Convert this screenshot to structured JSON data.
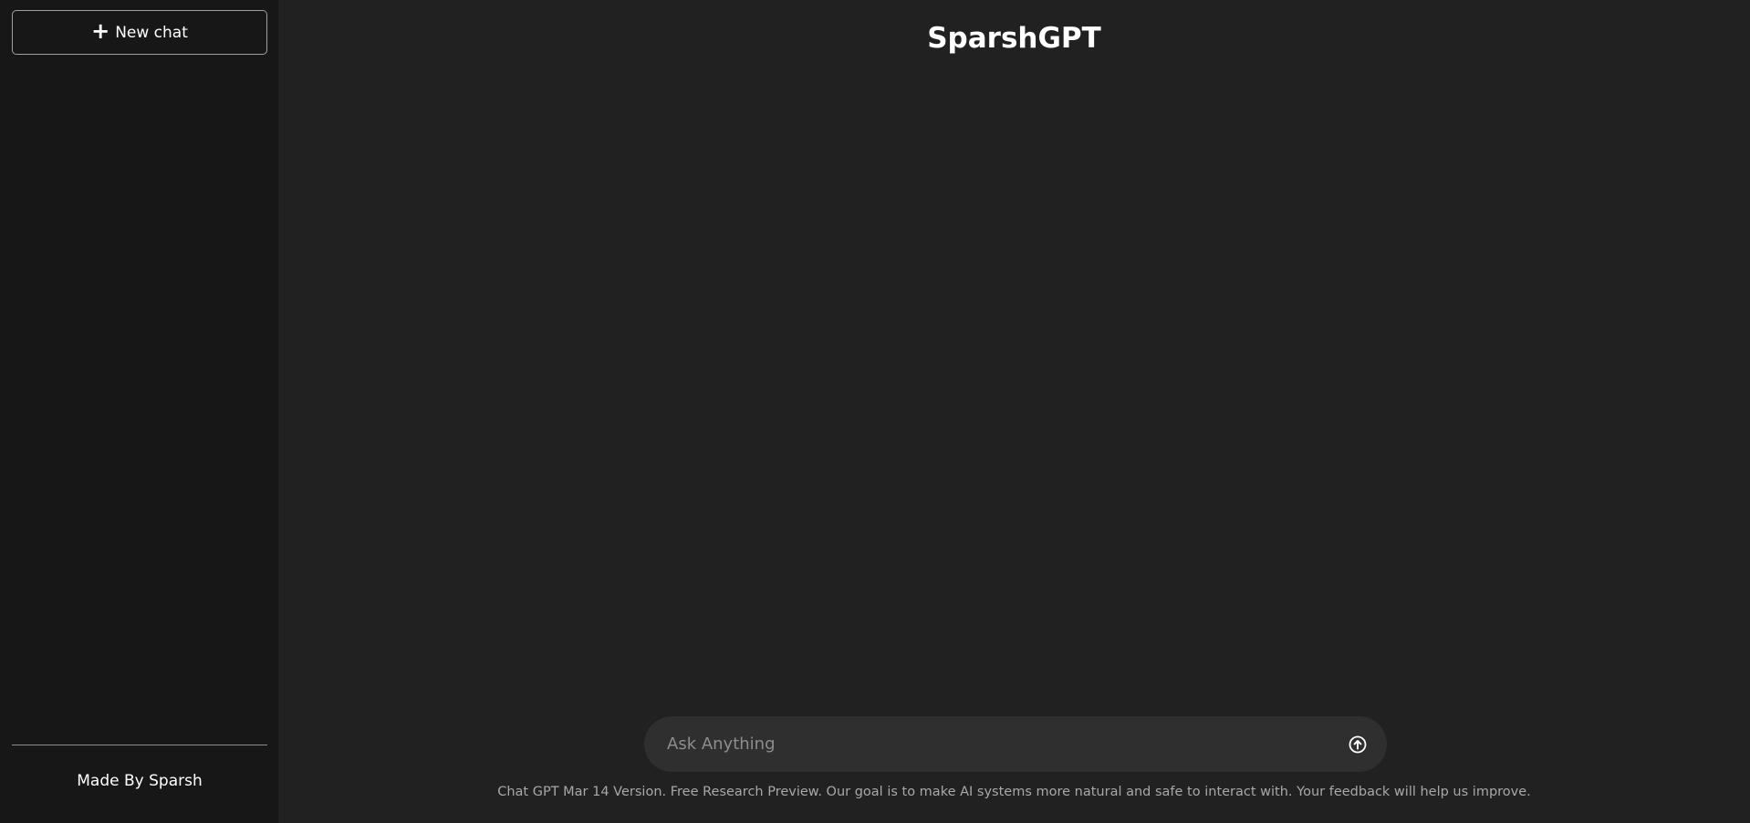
{
  "sidebar": {
    "new_chat_label": "New chat",
    "footer_label": "Made By Sparsh"
  },
  "main": {
    "title": "SparshGPT",
    "input": {
      "placeholder": "Ask Anything",
      "value": ""
    },
    "disclaimer": "Chat GPT Mar 14 Version. Free Research Preview. Our goal is to make AI systems more natural and safe to interact with. Your feedback will help us improve."
  },
  "icons": {
    "new_chat": "plus-icon",
    "send": "arrow-up-circle-icon"
  },
  "colors": {
    "sidebar_bg": "#171717",
    "main_bg": "#212121",
    "input_bg": "#2f2f2f",
    "text": "#ffffff",
    "muted_text": "#a8a8a8"
  }
}
